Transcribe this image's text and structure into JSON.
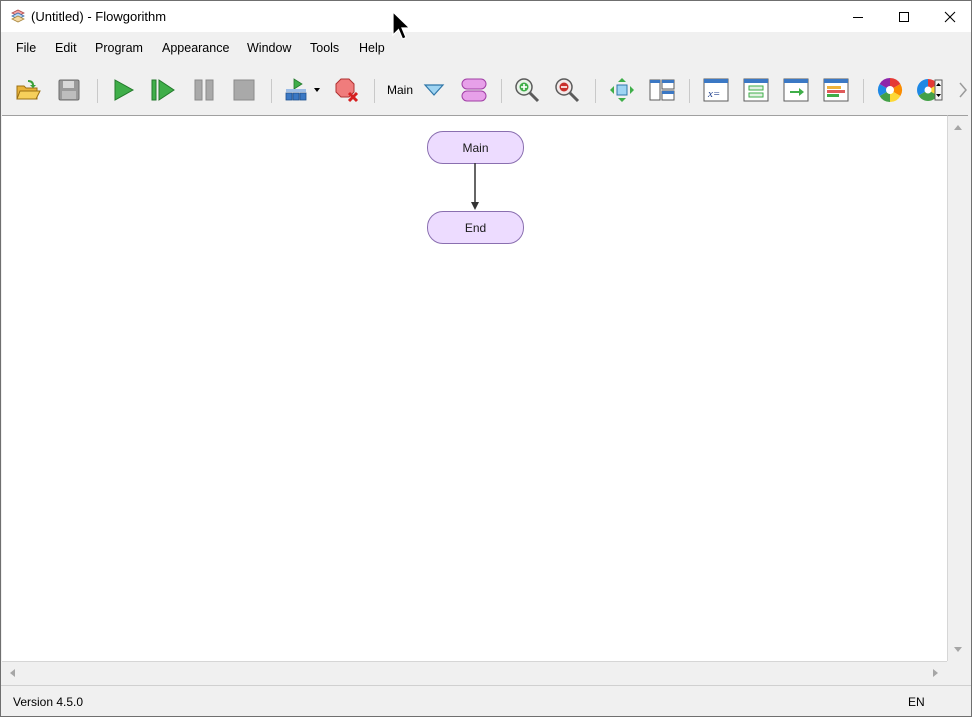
{
  "window": {
    "title": "(Untitled) - Flowgorithm"
  },
  "menu": [
    "File",
    "Edit",
    "Program",
    "Appearance",
    "Window",
    "Tools",
    "Help"
  ],
  "toolbar": {
    "function_selector": "Main"
  },
  "flowchart": {
    "start_label": "Main",
    "end_label": "End"
  },
  "status": {
    "version": "Version 4.5.0",
    "language": "EN"
  },
  "colors": {
    "terminal_fill": "#eddcff",
    "terminal_border": "#8a6fb0",
    "run_green": "#3fae49"
  }
}
